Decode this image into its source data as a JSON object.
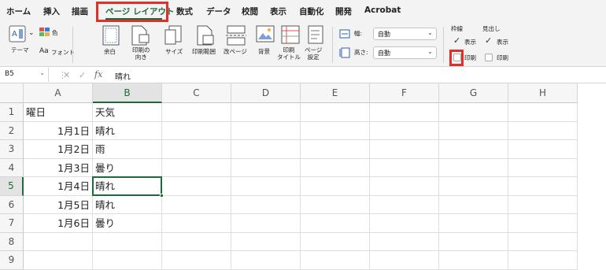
{
  "menu": {
    "tabs": [
      "ホーム",
      "挿入",
      "描画",
      "ページ レイアウト",
      "数式",
      "データ",
      "校閲",
      "表示",
      "自動化",
      "開発",
      "Acrobat"
    ],
    "active_tab": "ページ レイアウト"
  },
  "ribbon": {
    "theme_label": "テーマ",
    "colors_label": "色",
    "fonts_label": "フォント",
    "margins_label": "余白",
    "orientation_label": "印刷の\n向き",
    "size_label": "サイズ",
    "print_area_label": "印刷範囲",
    "breaks_label": "改ページ",
    "background_label": "背景",
    "print_titles_label": "印刷\nタイトル",
    "page_setup_label": "ページ\n設定",
    "width_label": "幅:",
    "width_value": "自動",
    "height_label": "高さ:",
    "height_value": "自動",
    "gridlines_header": "枠線",
    "headings_header": "見出し",
    "view_label": "表示",
    "print_label": "印刷",
    "gridlines_view_checked": true,
    "gridlines_print_checked": false,
    "headings_view_checked": true,
    "headings_print_checked": false
  },
  "formula_bar": {
    "name_box": "B5",
    "fx_label": "fx",
    "value": "晴れ"
  },
  "sheet": {
    "columns": [
      "A",
      "B",
      "C",
      "D",
      "E",
      "F",
      "G",
      "H"
    ],
    "rows": [
      "1",
      "2",
      "3",
      "4",
      "5",
      "6",
      "7",
      "8",
      "9"
    ],
    "active_cell": "B5",
    "cells": [
      [
        "曜日",
        "天気"
      ],
      [
        "1月1日",
        "晴れ"
      ],
      [
        "1月2日",
        "雨"
      ],
      [
        "1月3日",
        "曇り"
      ],
      [
        "1月4日",
        "晴れ"
      ],
      [
        "1月5日",
        "晴れ"
      ],
      [
        "1月6日",
        "曇り"
      ],
      [
        "",
        ""
      ],
      [
        "",
        ""
      ]
    ]
  },
  "colors": {
    "accent": "#1d6b3a",
    "highlight": "#e0302a"
  }
}
